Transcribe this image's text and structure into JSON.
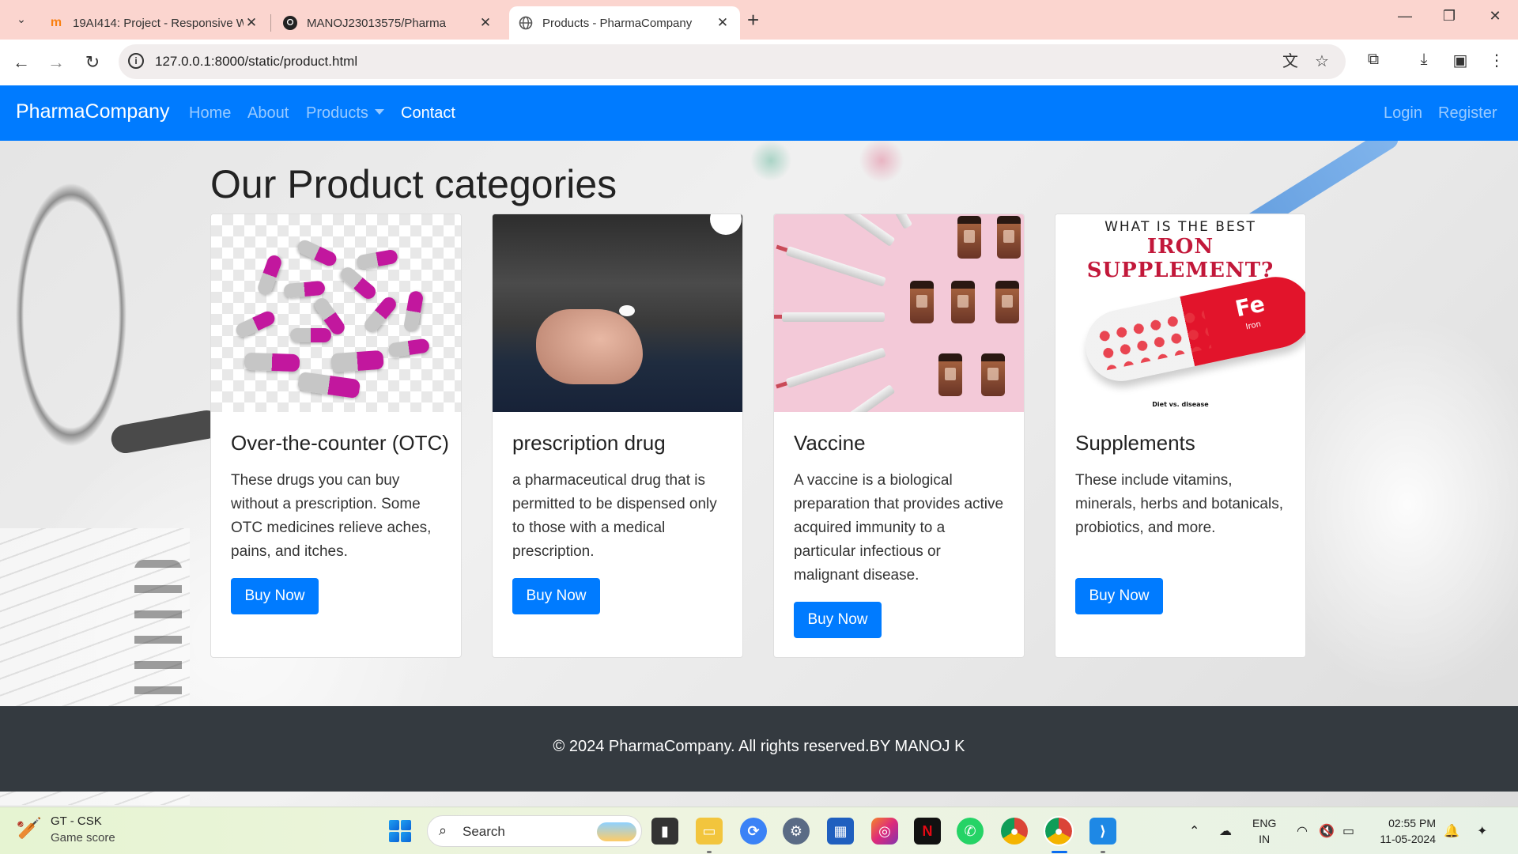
{
  "browser": {
    "tabs": [
      {
        "title": "19AI414: Project - Responsive W",
        "favicon": "moodle-icon"
      },
      {
        "title": "MANOJ23013575/Pharma",
        "favicon": "github-icon"
      },
      {
        "title": "Products - PharmaCompany",
        "favicon": "globe-icon",
        "active": true
      }
    ],
    "url": "127.0.0.1:8000/static/product.html"
  },
  "site": {
    "brand": "PharmaCompany",
    "nav": [
      "Home",
      "About",
      "Products",
      "Contact"
    ],
    "nav_right": [
      "Login",
      "Register"
    ],
    "heading": "Our Product categories",
    "cards": [
      {
        "title": "Over-the-counter (OTC)",
        "text": "These drugs you can buy without a prescription. Some OTC medicines relieve aches, pains, and itches.",
        "button": "Buy Now"
      },
      {
        "title": "prescription drug",
        "text": "a pharmaceutical drug that is permitted to be dispensed only to those with a medical prescription.",
        "button": "Buy Now"
      },
      {
        "title": "Vaccine",
        "text": "A vaccine is a biological preparation that provides active acquired immunity to a particular infectious or malignant disease.",
        "button": "Buy Now"
      },
      {
        "title": "Supplements",
        "text": "These include vitamins, minerals, herbs and botanicals, probiotics, and more.",
        "button": "Buy Now"
      }
    ],
    "supplement_image": {
      "line1": "WHAT IS THE BEST",
      "line2": "IRON SUPPLEMENT?",
      "fe": "Fe",
      "iron": "Iron",
      "footer": "Diet vs. disease"
    },
    "footer": "© 2024 PharmaCompany. All rights reserved.BY MANOJ K"
  },
  "taskbar": {
    "widget_title": "GT - CSK",
    "widget_subtitle": "Game score",
    "search_label": "Search",
    "lang_line1": "ENG",
    "lang_line2": "IN",
    "time": "02:55 PM",
    "date": "11-05-2024"
  },
  "colors": {
    "navbar": "#007bff",
    "footer": "#343a40",
    "button": "#007bff",
    "tabbar": "#fbd5cf"
  }
}
